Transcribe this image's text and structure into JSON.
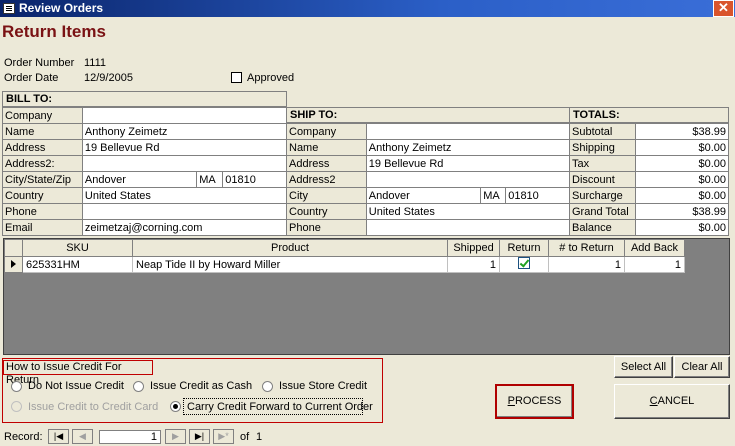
{
  "window": {
    "title": "Review Orders",
    "close_glyph": "✕"
  },
  "form": {
    "heading": "Return Items",
    "order_number_label": "Order Number",
    "order_number": "1111",
    "order_date_label": "Order Date",
    "order_date": "12/9/2005",
    "approved_label": "Approved",
    "approved": false
  },
  "bill_to": {
    "header": "BILL TO:",
    "rows": [
      {
        "label": "Company",
        "value": ""
      },
      {
        "label": "Name",
        "value": "Anthony Zeimetz"
      },
      {
        "label": "Address",
        "value": "19 Bellevue Rd"
      },
      {
        "label": "Address2:",
        "value": ""
      },
      {
        "label": "City/State/Zip",
        "value": "Andover",
        "state": "MA",
        "zip": "01810"
      },
      {
        "label": "Country",
        "value": "United States"
      },
      {
        "label": "Phone",
        "value": ""
      },
      {
        "label": "Email",
        "value": "zeimetzaj@corning.com"
      }
    ]
  },
  "ship_to": {
    "header": "SHIP TO:",
    "rows": [
      {
        "label": "Company",
        "value": ""
      },
      {
        "label": "Name",
        "value": "Anthony Zeimetz"
      },
      {
        "label": "Address",
        "value": "19 Bellevue Rd"
      },
      {
        "label": "Address2",
        "value": ""
      },
      {
        "label": "City",
        "value": "Andover",
        "state": "MA",
        "zip": "01810"
      },
      {
        "label": "Country",
        "value": "United States"
      },
      {
        "label": "Phone",
        "value": ""
      }
    ]
  },
  "totals": {
    "header": "TOTALS:",
    "rows": [
      {
        "label": "Subtotal",
        "value": "$38.99"
      },
      {
        "label": "Shipping",
        "value": "$0.00"
      },
      {
        "label": "Tax",
        "value": "$0.00"
      },
      {
        "label": "Discount",
        "value": "$0.00"
      },
      {
        "label": "Surcharge",
        "value": "$0.00"
      },
      {
        "label": "Grand Total",
        "value": "$38.99"
      },
      {
        "label": "Balance",
        "value": "$0.00"
      }
    ]
  },
  "items": {
    "columns": [
      "SKU",
      "Product",
      "Shipped",
      "Return",
      "# to Return",
      "Add Back"
    ],
    "rows": [
      {
        "sku": "625331HM",
        "product": "Neap Tide II by Howard Miller",
        "shipped": "1",
        "return": true,
        "to_return": "1",
        "add_back": "1"
      }
    ]
  },
  "credit": {
    "title": "How to Issue Credit For Return",
    "options": [
      {
        "label": "Do Not Issue Credit",
        "selected": false,
        "enabled": true
      },
      {
        "label": "Issue Credit as Cash",
        "selected": false,
        "enabled": true
      },
      {
        "label": "Issue Store Credit",
        "selected": false,
        "enabled": true
      },
      {
        "label": "Issue Credit to Credit Card",
        "selected": false,
        "enabled": false
      },
      {
        "label": "Carry Credit Forward to Current Order",
        "selected": true,
        "enabled": true
      }
    ]
  },
  "buttons": {
    "select_all": "Select All",
    "clear_all": "Clear All",
    "process_u": "P",
    "process_rest": "ROCESS",
    "cancel_u": "C",
    "cancel_rest": "ANCEL"
  },
  "record_nav": {
    "label": "Record:",
    "current": "1",
    "of_label": "of",
    "total": "1"
  },
  "icons": [
    "window-icon",
    "close-icon",
    "row-pointer-icon",
    "check-icon",
    "first-record-icon",
    "prev-record-icon",
    "next-record-icon",
    "last-record-icon",
    "new-record-icon"
  ]
}
